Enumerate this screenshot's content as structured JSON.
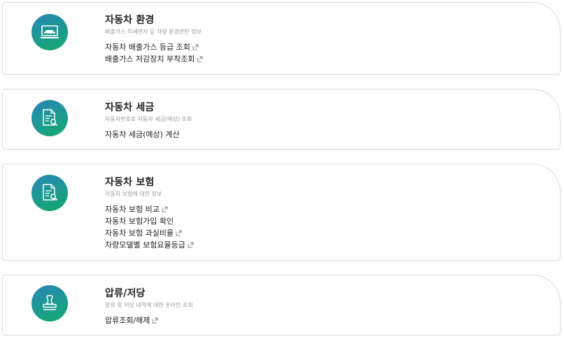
{
  "sections": [
    {
      "title": "자동차 환경",
      "description": "배출가스 미세먼지 등 차량 환경관련 정보",
      "icon": "car-laptop-icon",
      "links": [
        {
          "label": "자동차 배출가스 등급 조회",
          "external": true
        },
        {
          "label": "배출가스 저감장치 부착조회",
          "external": true
        }
      ]
    },
    {
      "title": "자동차 세금",
      "description": "자동차번호로 자동차 세금(예상) 조회",
      "icon": "document-search-icon",
      "links": [
        {
          "label": "자동차 세금(예상) 계산",
          "external": false
        }
      ]
    },
    {
      "title": "자동차 보험",
      "description": "자동차 보험에 대한 정보",
      "icon": "document-search-icon",
      "links": [
        {
          "label": "자동차 보험 비교",
          "external": true
        },
        {
          "label": "자동차 보험가입 확인",
          "external": false
        },
        {
          "label": "자동차 보험 과실비율",
          "external": true
        },
        {
          "label": "차량모델별 보험요율등급",
          "external": true
        }
      ]
    },
    {
      "title": "압류/저당",
      "description": "압류 및 저당 내역에 대한 온라인 조회",
      "icon": "stamp-icon",
      "links": [
        {
          "label": "압류조회/해제",
          "external": true
        }
      ]
    }
  ],
  "colors": {
    "icon_gradient_start": "#2a86b8",
    "icon_gradient_end": "#14a86e",
    "border": "#dcdcdc",
    "description": "#9a9a9a"
  }
}
